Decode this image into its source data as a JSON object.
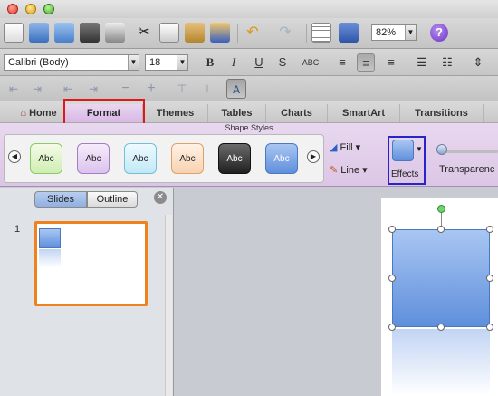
{
  "font": {
    "name": "Calibri (Body)",
    "size": "18"
  },
  "zoom": "82%",
  "ribbon": {
    "tabs": [
      "Home",
      "Format",
      "Themes",
      "Tables",
      "Charts",
      "SmartArt",
      "Transitions"
    ],
    "group_title": "Shape Styles",
    "swatch_label": "Abc",
    "fill_label": "Fill",
    "line_label": "Line",
    "effects_label": "Effects",
    "transparency_label": "Transparenc"
  },
  "pane": {
    "slides_tab": "Slides",
    "outline_tab": "Outline",
    "slide_number": "1"
  },
  "colors": {
    "active_tab": "#d8b7e4",
    "shape_fill": "#5f8fdc",
    "selected_thumb": "#f0821e",
    "callout_red": "#e01818",
    "callout_blue": "#2a23c9"
  }
}
